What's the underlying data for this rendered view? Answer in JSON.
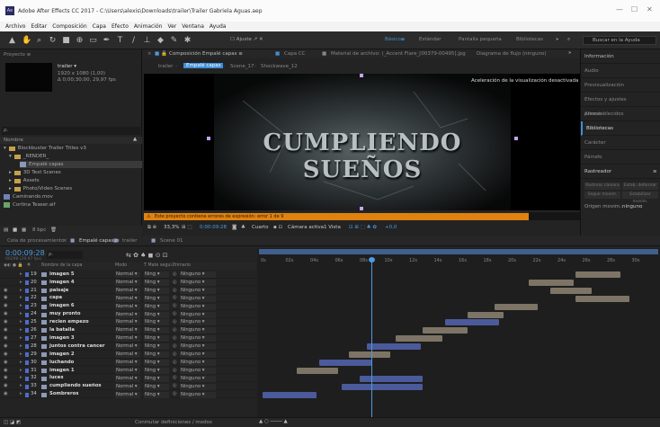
{
  "window": {
    "title": "Adobe After Effects CC 2017 - C:\\Users\\alexis\\Downloads\\trailer\\Trailer Gabriela Aguas.aep",
    "app_icon": "Ae",
    "controls": [
      "—",
      "☐",
      "✕"
    ]
  },
  "menu": [
    "Archivo",
    "Editar",
    "Composición",
    "Capa",
    "Efecto",
    "Animación",
    "Ver",
    "Ventana",
    "Ayuda"
  ],
  "toolbar": {
    "align_label": "Ajuste",
    "workspaces": [
      "Básicos",
      "Estándar",
      "Pantalla pequeña",
      "Bibliotecas"
    ],
    "active_workspace": "Básicos",
    "more": "»",
    "search_placeholder": "Buscar en la Ayuda"
  },
  "project": {
    "tab": "Proyecto ≡",
    "selected": "trailer ▾",
    "info": [
      "1920 x 1080 (1,00)",
      "Δ 0;00;30;00, 29,97 fps"
    ],
    "search": "ρ.",
    "column": "Nombre",
    "items": [
      {
        "name": "Blockbuster Trailer Titles v3",
        "type": "folder",
        "indent": 0
      },
      {
        "name": "_RENDER_",
        "type": "folder",
        "indent": 1
      },
      {
        "name": "Empalé capas",
        "type": "comp",
        "indent": 2
      },
      {
        "name": "3D Text Scenes",
        "type": "folder",
        "indent": 1
      },
      {
        "name": "Assets",
        "type": "folder",
        "indent": 1
      },
      {
        "name": "Photo/Video Scenes",
        "type": "folder",
        "indent": 1
      },
      {
        "name": "Caminando.mov",
        "type": "file",
        "indent": 0
      },
      {
        "name": "Cortina Teaser.aif",
        "type": "file",
        "indent": 0
      }
    ],
    "bpc": "8 bpc"
  },
  "composition": {
    "tabs": [
      "Composición Empalé capas ≡",
      "Capa CC",
      "Material de archivo: (_Accent Flare_[00379-00495].jpg",
      "Diagrama de flujo (ninguno)"
    ],
    "breadcrumbs": [
      "trailer",
      "Empalé capas",
      "Scene_17",
      "Shockwave_12"
    ],
    "viewer_title": "CUMPLIENDO SUEÑOS",
    "accel_notice": "Aceleración de la visualización desactivada",
    "error": "Este proyecto contiene errores de expresión: error 1 de 9",
    "zoom": "33,3%",
    "timecode": "0:00:09:28",
    "resolution": "Cuarto",
    "camera": "Cámara activa",
    "views": "1 Vista",
    "offset": "+0,0"
  },
  "right_panel": {
    "items": [
      "Información",
      "Audio",
      "Previsualización",
      "Efectos y ajustes preestablecidos",
      "Alinear",
      "Bibliotecas",
      "Carácter",
      "Párrafo",
      "Rastreador"
    ],
    "tracker_buttons": [
      "Rastrear cámara",
      "Estab. deformar",
      "Seguir movim.",
      "Estabilizar movim."
    ],
    "origin_label": "Origen movim.:",
    "origin_value": "ninguno",
    "active_item": "Bibliotecas"
  },
  "timeline": {
    "tabs": [
      "Cola de procesamiento",
      "Empalé capas ≡",
      "trailer",
      "Scene 01"
    ],
    "active_tab": "Empalé capas ≡",
    "timecode": "0:00:09:28",
    "frames": "00298 (29.97 fps)",
    "columns": [
      "Nombre de la capa",
      "Modo",
      "T  Mate segui...",
      "Primario"
    ],
    "ticks": [
      "0s",
      "02s",
      "04s",
      "06s",
      "08s",
      "10s",
      "12s",
      "14s",
      "16s",
      "18s",
      "20s",
      "22s",
      "24s",
      "26s",
      "28s",
      "30s"
    ],
    "layers": [
      {
        "num": "19",
        "name": "imagen 5",
        "mode": "Normal",
        "matte": "Ning",
        "parent": "Ninguno"
      },
      {
        "num": "20",
        "name": "imagen 4",
        "mode": "Normal",
        "matte": "Ning",
        "parent": "Ninguno"
      },
      {
        "num": "21",
        "name": "paisaje",
        "mode": "Normal",
        "matte": "Ning",
        "parent": "Ninguno"
      },
      {
        "num": "22",
        "name": "capa",
        "mode": "Normal",
        "matte": "Ning",
        "parent": "Ninguno"
      },
      {
        "num": "23",
        "name": "imagen 6",
        "mode": "Normal",
        "matte": "Ning",
        "parent": "Ninguno"
      },
      {
        "num": "24",
        "name": "muy pronto",
        "mode": "Normal",
        "matte": "Ning",
        "parent": "Ninguno"
      },
      {
        "num": "25",
        "name": "recien empezo",
        "mode": "Normal",
        "matte": "Ning",
        "parent": "Ninguno"
      },
      {
        "num": "26",
        "name": "la batalla",
        "mode": "Normal",
        "matte": "Ning",
        "parent": "Ninguno"
      },
      {
        "num": "27",
        "name": "imagen 3",
        "mode": "Normal",
        "matte": "Ning",
        "parent": "Ninguno"
      },
      {
        "num": "28",
        "name": "juntos contra cancer",
        "mode": "Normal",
        "matte": "Ning",
        "parent": "Ninguno"
      },
      {
        "num": "29",
        "name": "imagen 2",
        "mode": "Normal",
        "matte": "Ning",
        "parent": "Ninguno"
      },
      {
        "num": "30",
        "name": "luchando",
        "mode": "Normal",
        "matte": "Ning",
        "parent": "Ninguno"
      },
      {
        "num": "31",
        "name": "imagen 1",
        "mode": "Normal",
        "matte": "Ning",
        "parent": "Ninguno"
      },
      {
        "num": "32",
        "name": "luces",
        "mode": "Normal",
        "matte": "Ning",
        "parent": "Ninguno"
      },
      {
        "num": "33",
        "name": "cumpliendo sueños",
        "mode": "Normal",
        "matte": "Ning",
        "parent": "Ninguno"
      },
      {
        "num": "34",
        "name": "Sombreros",
        "mode": "Normal",
        "matte": "Ning",
        "parent": "Ninguno"
      }
    ],
    "toggle_label": "Conmutar definiciones / modos"
  },
  "colors": {
    "accent": "#3f8fd7",
    "error_bar": "#e0820f",
    "tan": "#7d7466",
    "bluebar": "#4b5a9a"
  }
}
